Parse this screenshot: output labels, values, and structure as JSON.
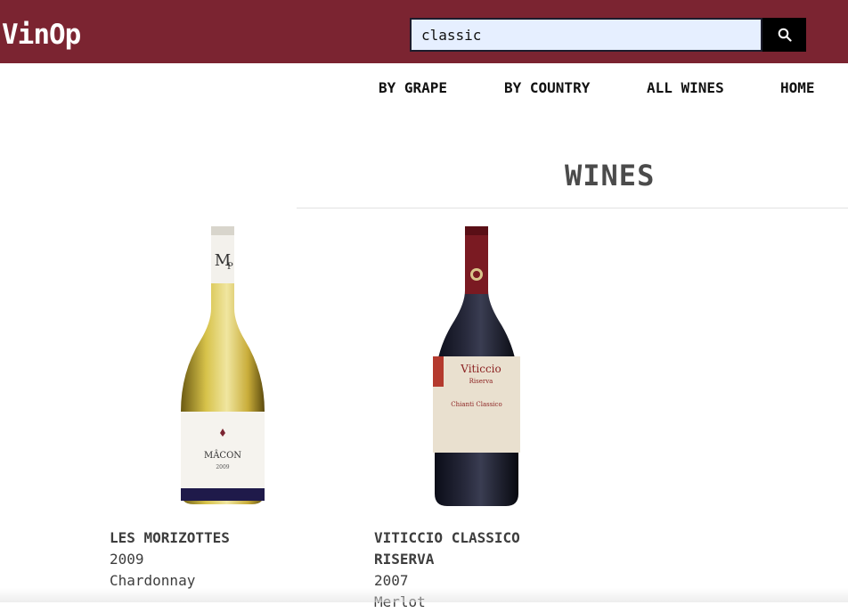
{
  "header": {
    "logo": "VinOp",
    "search_value": "classic",
    "search_icon": "search-icon",
    "brand_color": "#7b2431"
  },
  "nav": {
    "items": [
      {
        "label": "BY GRAPE"
      },
      {
        "label": "BY COUNTRY"
      },
      {
        "label": "ALL WINES"
      },
      {
        "label": "HOME"
      }
    ]
  },
  "main": {
    "title": "WINES",
    "wines": [
      {
        "name": "LES MORIZOTTES",
        "year": "2009",
        "grape": "Chardonnay",
        "bottle_style": "white-wine-bottle"
      },
      {
        "name_line1": "VITICCIO CLASSICO",
        "name_line2": "RISERVA",
        "year": "2007",
        "grape": "Merlot",
        "bottle_style": "red-wine-bottle"
      }
    ]
  }
}
